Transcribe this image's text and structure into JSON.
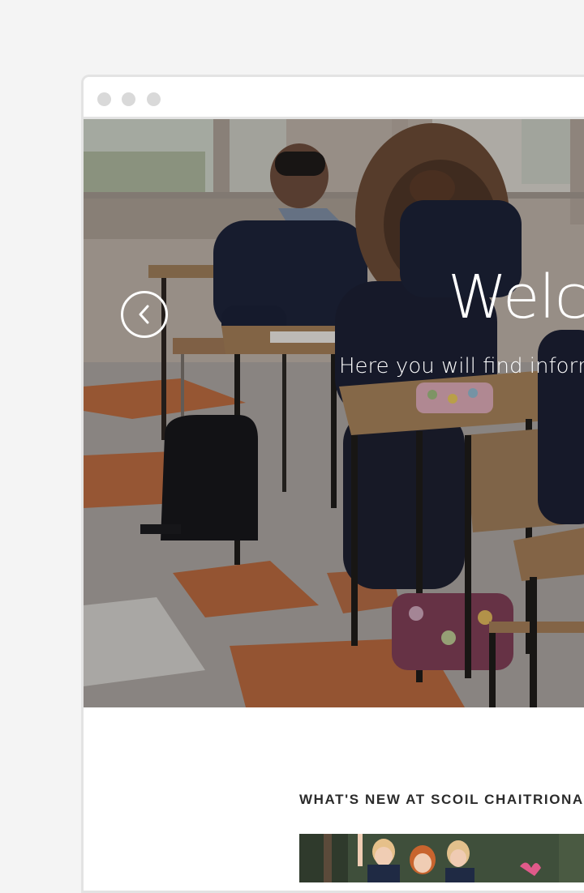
{
  "hero": {
    "title": "Welco",
    "subtitle": "Here you will find inforr",
    "prev_icon": "chevron-left-icon"
  },
  "news": {
    "heading": "WHAT'S NEW AT SCOIL CHAITRIONA"
  },
  "colors": {
    "page_background": "#f4f4f4",
    "window_border": "#e3e3e3",
    "window_dots": "#d9d9d9",
    "heading_text": "#2b2b2b",
    "hero_text": "#ffffff"
  }
}
